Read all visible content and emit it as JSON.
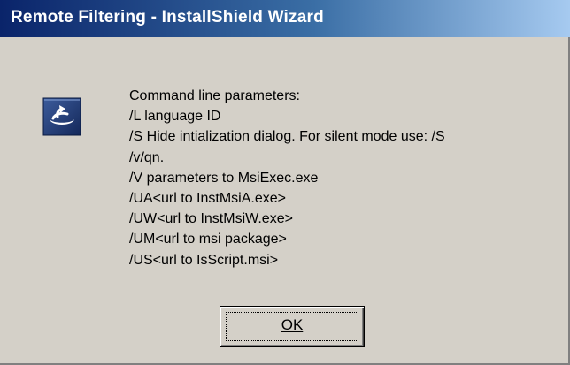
{
  "window": {
    "title": "Remote Filtering - InstallShield Wizard"
  },
  "icon": {
    "name": "installshield-icon"
  },
  "message": {
    "lines": [
      "Command line parameters:",
      "/L language ID",
      "/S Hide intialization dialog.  For silent mode use: /S",
      "/v/qn.",
      "/V parameters to MsiExec.exe",
      "/UA<url to InstMsiA.exe>",
      "/UW<url to InstMsiW.exe>",
      "/UM<url to msi package>",
      "/US<url to IsScript.msi>"
    ]
  },
  "buttons": {
    "ok_label": "OK"
  },
  "colors": {
    "title_start": "#0a246a",
    "title_end": "#a6caf0",
    "dialog_bg": "#d4d0c8"
  }
}
